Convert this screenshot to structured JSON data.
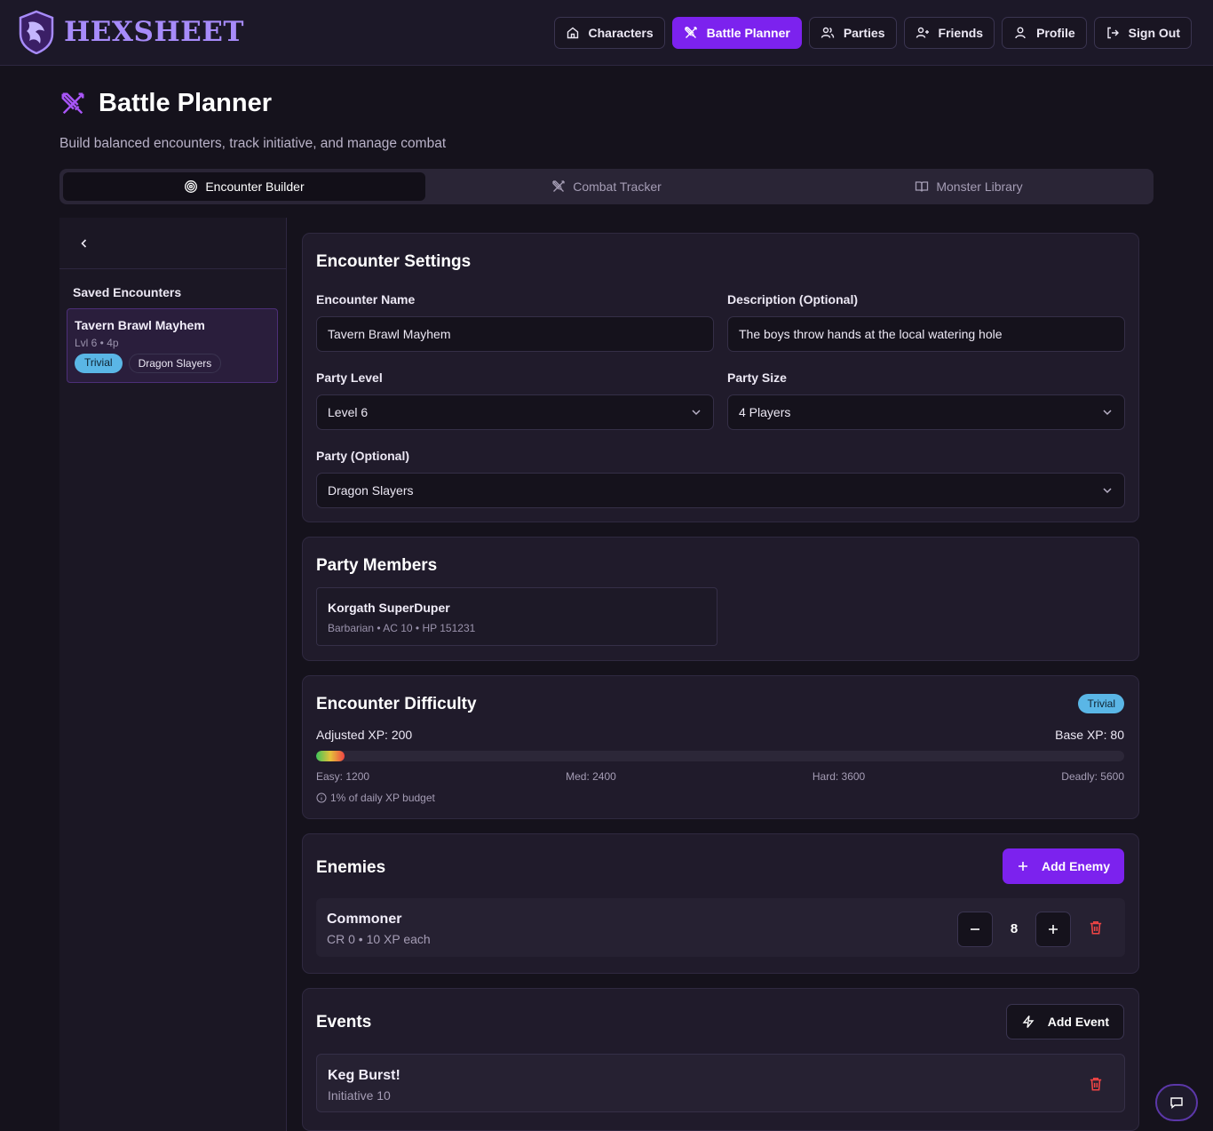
{
  "app": {
    "name": "HEXSHEET"
  },
  "nav": {
    "characters": "Characters",
    "battle_planner": "Battle Planner",
    "parties": "Parties",
    "friends": "Friends",
    "profile": "Profile",
    "sign_out": "Sign Out"
  },
  "page": {
    "title": "Battle Planner",
    "subtitle": "Build balanced encounters, track initiative, and manage combat"
  },
  "tabs": [
    {
      "label": "Encounter Builder",
      "active": true
    },
    {
      "label": "Combat Tracker",
      "active": false
    },
    {
      "label": "Monster Library",
      "active": false
    }
  ],
  "sidebar": {
    "heading": "Saved Encounters",
    "encounters": [
      {
        "name": "Tavern Brawl Mayhem",
        "meta": "Lvl 6 • 4p",
        "difficulty": "Trivial",
        "party": "Dragon Slayers"
      }
    ]
  },
  "settings": {
    "title": "Encounter Settings",
    "name_label": "Encounter Name",
    "name_value": "Tavern Brawl Mayhem",
    "desc_label": "Description (Optional)",
    "desc_value": "The boys throw hands at the local watering hole",
    "level_label": "Party Level",
    "level_value": "Level 6",
    "size_label": "Party Size",
    "size_value": "4 Players",
    "party_label": "Party (Optional)",
    "party_value": "Dragon Slayers"
  },
  "members": {
    "title": "Party Members",
    "list": [
      {
        "name": "Korgath SuperDuper",
        "meta": "Barbarian • AC 10 • HP 151231"
      }
    ]
  },
  "difficulty": {
    "title": "Encounter Difficulty",
    "badge": "Trivial",
    "adjusted_xp": "Adjusted XP: 200",
    "base_xp": "Base XP: 80",
    "bar_fill_fraction": 0.035,
    "thresholds": {
      "easy": "Easy: 1200",
      "medium": "Med: 2400",
      "hard": "Hard: 3600",
      "deadly": "Deadly: 5600"
    },
    "budget_note": "1% of daily XP budget"
  },
  "enemies": {
    "title": "Enemies",
    "add_label": "Add Enemy",
    "list": [
      {
        "name": "Commoner",
        "meta": "CR 0 • 10 XP each",
        "count": "8"
      }
    ]
  },
  "events": {
    "title": "Events",
    "add_label": "Add Event",
    "list": [
      {
        "name": "Keg Burst!",
        "meta": "Initiative 10"
      }
    ]
  },
  "colors": {
    "accent": "#7c22ee",
    "trivial_badge": "#5ab6e6",
    "danger": "#ef4444",
    "background": "#15121c"
  }
}
